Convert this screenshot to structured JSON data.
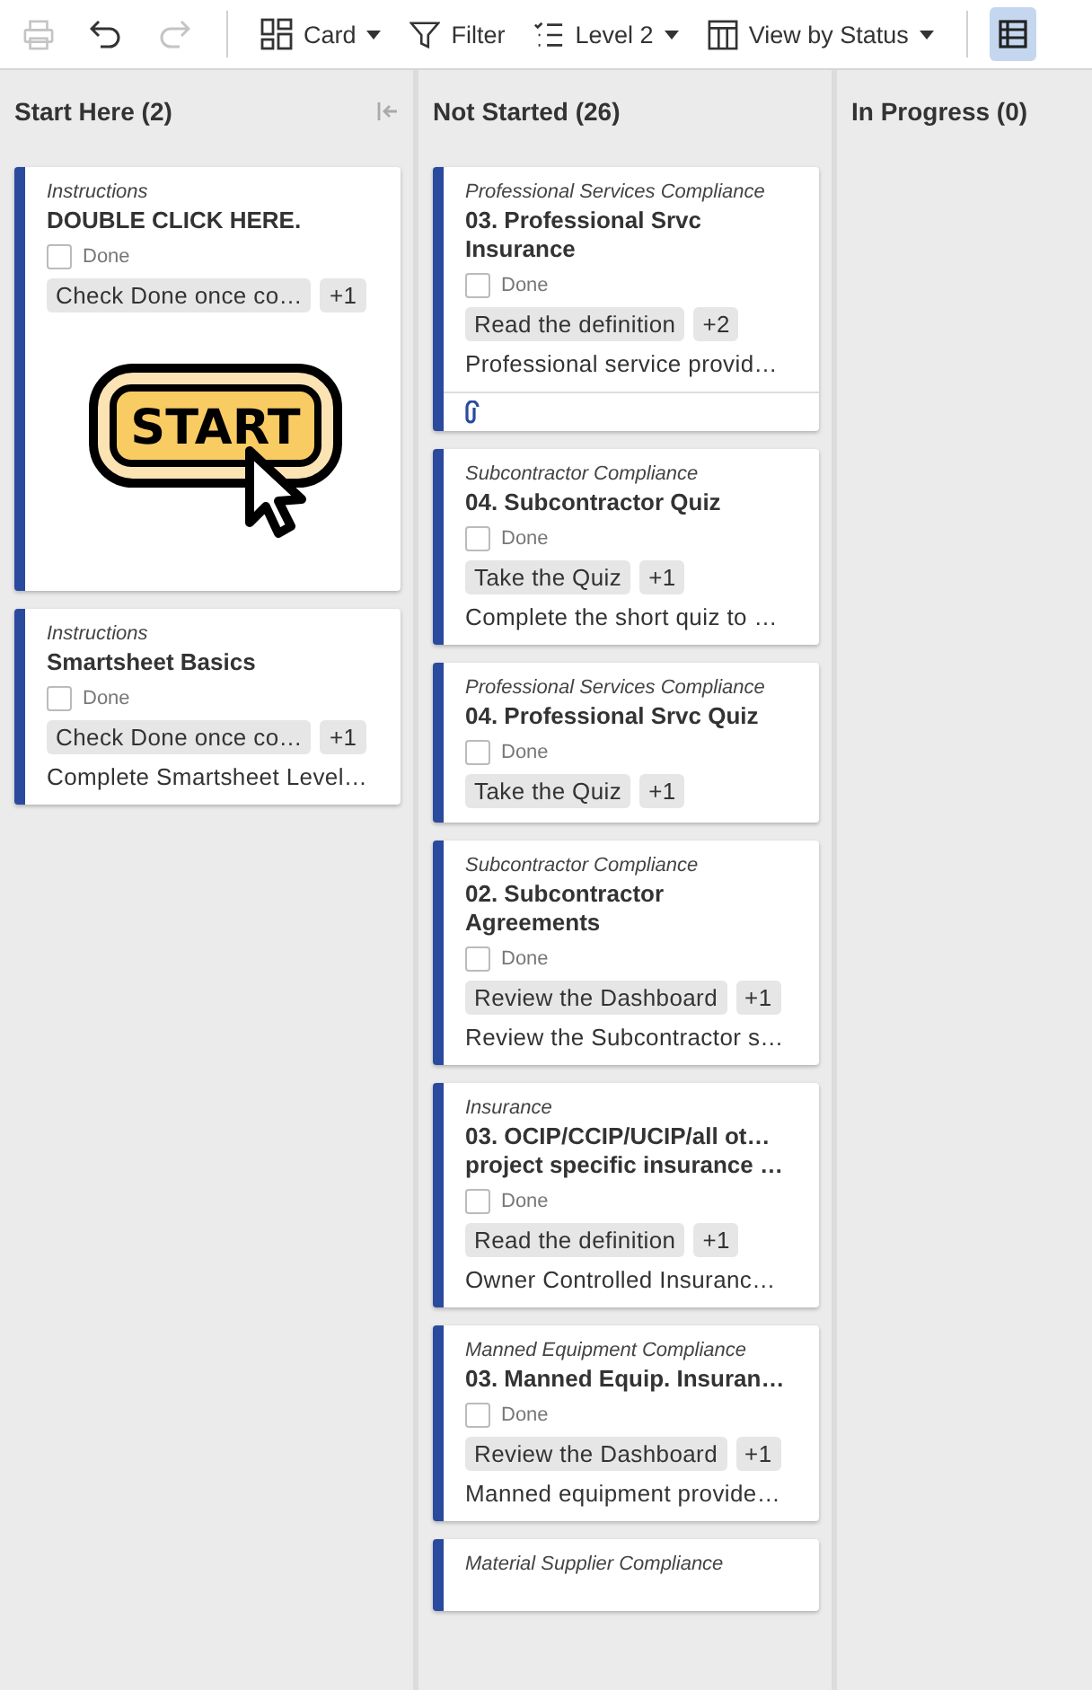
{
  "toolbar": {
    "print_disabled": true,
    "redo_disabled": true,
    "items": [
      {
        "kind": "card",
        "label": "Card",
        "dropdown": true
      },
      {
        "kind": "filter",
        "label": "Filter",
        "dropdown": false
      },
      {
        "kind": "level",
        "label": "Level 2",
        "dropdown": true
      },
      {
        "kind": "view",
        "label": "View by Status",
        "dropdown": true
      }
    ],
    "grid_view_selected": true
  },
  "columns": [
    {
      "title": "Start Here (2)",
      "collapsible": true,
      "cards": [
        {
          "kind": "full",
          "category": "Instructions",
          "title_lines": [
            "DOUBLE CLICK HERE."
          ],
          "done": false,
          "done_label": "Done",
          "tag": "Check Done once co…",
          "more": "+1",
          "image_label": "START"
        },
        {
          "kind": "full",
          "category": "Instructions",
          "title_lines": [
            "Smartsheet Basics"
          ],
          "done": false,
          "done_label": "Done",
          "tag": "Check Done once co…",
          "more": "+1",
          "description": "Complete Smartsheet Level…"
        }
      ]
    },
    {
      "title": "Not Started (26)",
      "cards": [
        {
          "kind": "full",
          "category": "Professional Services Compliance",
          "title_lines": [
            "03. Professional Srvc",
            "Insurance"
          ],
          "done": false,
          "done_label": "Done",
          "tag": "Read the definition",
          "more": "+2",
          "description": "Professional service provid…",
          "attachment": true
        },
        {
          "kind": "full",
          "category": "Subcontractor Compliance",
          "title_lines": [
            "04. Subcontractor Quiz"
          ],
          "done": false,
          "done_label": "Done",
          "tag": "Take the Quiz",
          "more": "+1",
          "description": "Complete the short quiz to …"
        },
        {
          "kind": "full",
          "category": "Professional Services Compliance",
          "title_lines": [
            "04. Professional Srvc Quiz"
          ],
          "done": false,
          "done_label": "Done",
          "tag": "Take the Quiz",
          "more": "+1"
        },
        {
          "kind": "full",
          "category": "Subcontractor Compliance",
          "title_lines": [
            "02. Subcontractor",
            "Agreements"
          ],
          "done": false,
          "done_label": "Done",
          "tag": "Review the Dashboard",
          "more": "+1",
          "description": "Review the Subcontractor s…"
        },
        {
          "kind": "full",
          "category": "Insurance",
          "title_lines": [
            "03. OCIP/CCIP/UCIP/all ot…",
            "project specific insurance …"
          ],
          "done": false,
          "done_label": "Done",
          "tag": "Read the definition",
          "more": "+1",
          "description": "Owner Controlled Insuranc…"
        },
        {
          "kind": "full",
          "category": "Manned Equipment Compliance",
          "title_lines": [
            "03. Manned Equip. Insuran…"
          ],
          "done": false,
          "done_label": "Done",
          "tag": "Review the Dashboard",
          "more": "+1",
          "description": "Manned equipment provide…"
        },
        {
          "kind": "stub",
          "category": "Material Supplier Compliance"
        }
      ]
    },
    {
      "title": "In Progress (0)"
    }
  ]
}
